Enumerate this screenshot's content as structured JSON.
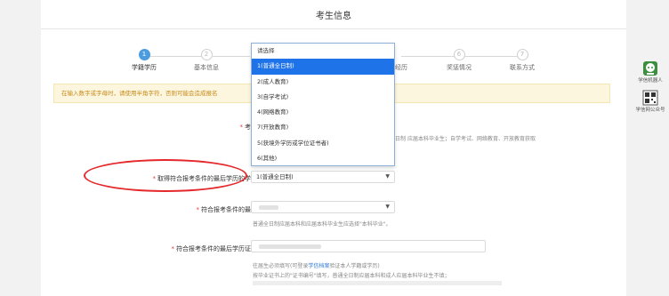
{
  "page": {
    "title": "考生信息"
  },
  "stepper": {
    "steps": [
      {
        "num": "1",
        "label": "学籍学历",
        "active": true
      },
      {
        "num": "2",
        "label": "基本信息",
        "active": false
      },
      {
        "num": "3",
        "label": "",
        "active": false
      },
      {
        "num": "4",
        "label": "",
        "active": false
      },
      {
        "num": "5",
        "label": "工作经历",
        "active": false
      },
      {
        "num": "6",
        "label": "奖惩情况",
        "active": false
      },
      {
        "num": "7",
        "label": "联系方式",
        "active": false
      }
    ]
  },
  "notice": {
    "text": "在输入数字或字母时，请使用半角字符，否则可能会造成报名"
  },
  "form": {
    "source": {
      "label": "考生来源：",
      "hint1": "应届本科毕业生；自学考试、网络教育、开放教育获取",
      "hint_prefix": "日制"
    },
    "study_form": {
      "label": "取得符合报考条件的最后学历的学习形式：",
      "value": "1(普通全日制)"
    },
    "last_degree": {
      "label": "符合报考条件的最后学历：",
      "hint": "普通全日制应届本科和应届本科毕业生应选择\"本科毕业\"。"
    },
    "cert_no": {
      "label": "符合报考条件的最后学历证书编号：",
      "hint1a": "往届生必须填写(可登录",
      "hint1_link": "学信档案",
      "hint1b": "验证本人学籍或学历)",
      "hint2": "按毕业证书上的\"证书编号\"填写，普通全日制应届本科和成人应届本科毕业生不填；"
    }
  },
  "dropdown": {
    "options": [
      "请选择",
      "1(普通全日制)",
      "2(成人教育)",
      "3(自学考试)",
      "4(网络教育)",
      "7(开放教育)",
      "5(获境外学历或学位证书者)",
      "6(其他)"
    ],
    "selected_index": 1
  },
  "side_float": {
    "robot_label": "学信机器人",
    "qr_label": "学信网公众号"
  },
  "colors": {
    "accent": "#4a9be0",
    "selected": "#1e73e8",
    "annotation": "#e4282c",
    "notice_text": "#c68a1b"
  }
}
